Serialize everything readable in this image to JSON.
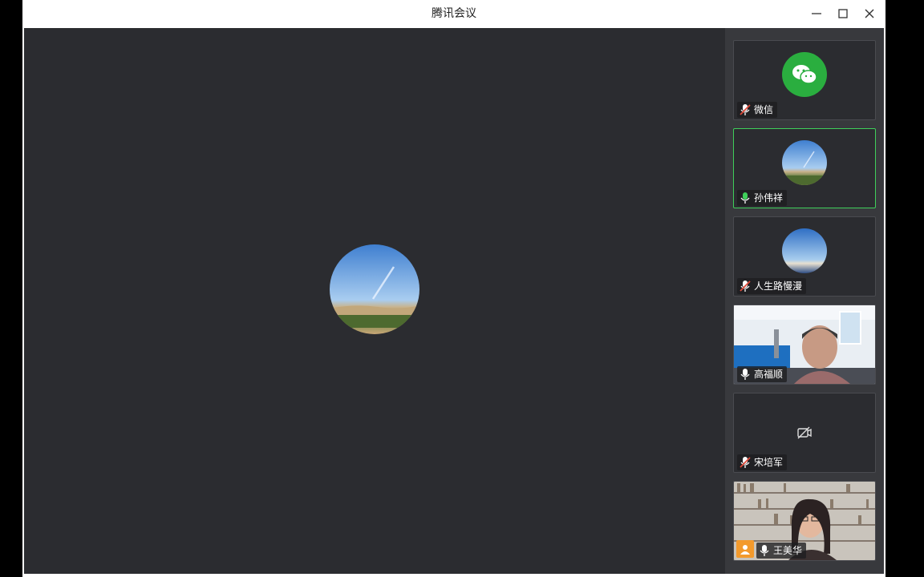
{
  "window": {
    "title": "腾讯会议"
  },
  "participants": [
    {
      "name": "微信",
      "mic": "muted",
      "avatar": "wechat-logo"
    },
    {
      "name": "孙伟祥",
      "mic": "speaking",
      "avatar": "desert-sky-photo"
    },
    {
      "name": "人生路慢漫",
      "mic": "muted",
      "avatar": "sky-horizon-photo"
    },
    {
      "name": "高福顺",
      "mic": "on",
      "avatar": "camera-video"
    },
    {
      "name": "宋培军",
      "mic": "muted",
      "avatar": "camera-off"
    },
    {
      "name": "王美华",
      "mic": "on",
      "avatar": "camera-video",
      "host": true
    }
  ],
  "colors": {
    "active_border": "#3fcf5a",
    "stage_bg": "#2b2c30",
    "sidebar_bg": "#38393d",
    "wechat_green": "#2aae3f",
    "host_badge": "#f39a2c",
    "muted_red": "#e04a3a"
  }
}
